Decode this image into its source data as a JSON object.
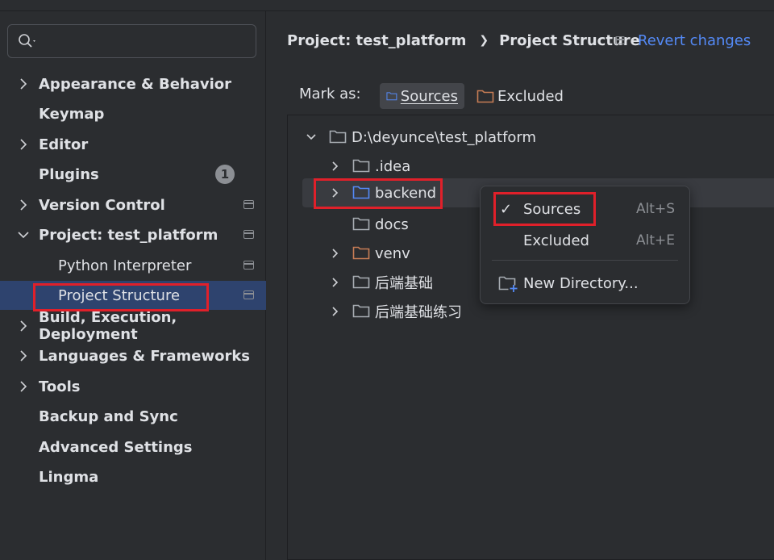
{
  "sidebar": {
    "search": {
      "placeholder": ""
    },
    "items": [
      {
        "label": "Appearance & Behavior",
        "expandable": true
      },
      {
        "label": "Keymap"
      },
      {
        "label": "Editor",
        "expandable": true
      },
      {
        "label": "Plugins",
        "badge": "1"
      },
      {
        "label": "Version Control",
        "expandable": true
      },
      {
        "label": "Project: test_platform",
        "expanded": true
      },
      {
        "label": "Python Interpreter"
      },
      {
        "label": "Project Structure",
        "selected": true
      },
      {
        "label": "Build, Execution, Deployment",
        "expandable": true
      },
      {
        "label": "Languages & Frameworks",
        "expandable": true
      },
      {
        "label": "Tools",
        "expandable": true
      },
      {
        "label": "Backup and Sync"
      },
      {
        "label": "Advanced Settings"
      },
      {
        "label": "Lingma"
      }
    ]
  },
  "header": {
    "breadcrumb": [
      "Project: test_platform",
      "Project Structure"
    ],
    "revert_label": "Revert changes"
  },
  "markas": {
    "label": "Mark as:",
    "sources_label": "Sources",
    "excluded_label": "Excluded"
  },
  "tree": {
    "root": "D:\\deyunce\\test_platform",
    "items": [
      {
        "label": ".idea",
        "folder_color": "#a8adb3"
      },
      {
        "label": "backend",
        "folder_color": "#548af7"
      },
      {
        "label": "docs",
        "folder_color": "#a8adb3"
      },
      {
        "label": "venv",
        "folder_color": "#c77d55"
      },
      {
        "label": "后端基础",
        "folder_color": "#a8adb3"
      },
      {
        "label": "后端基础练习",
        "folder_color": "#a8adb3"
      }
    ]
  },
  "popup": {
    "items": [
      {
        "check": "✓",
        "label": "Sources",
        "shortcut": "Alt+S"
      },
      {
        "label": "Excluded",
        "shortcut": "Alt+E"
      },
      {
        "label": "New Directory..."
      }
    ]
  },
  "colors": {
    "background": "#2b2d30",
    "selection": "#2e436e",
    "accent_link": "#548af7",
    "highlight_box": "#e0202a",
    "sources_folder": "#548af7",
    "excluded_folder": "#c77d55"
  }
}
